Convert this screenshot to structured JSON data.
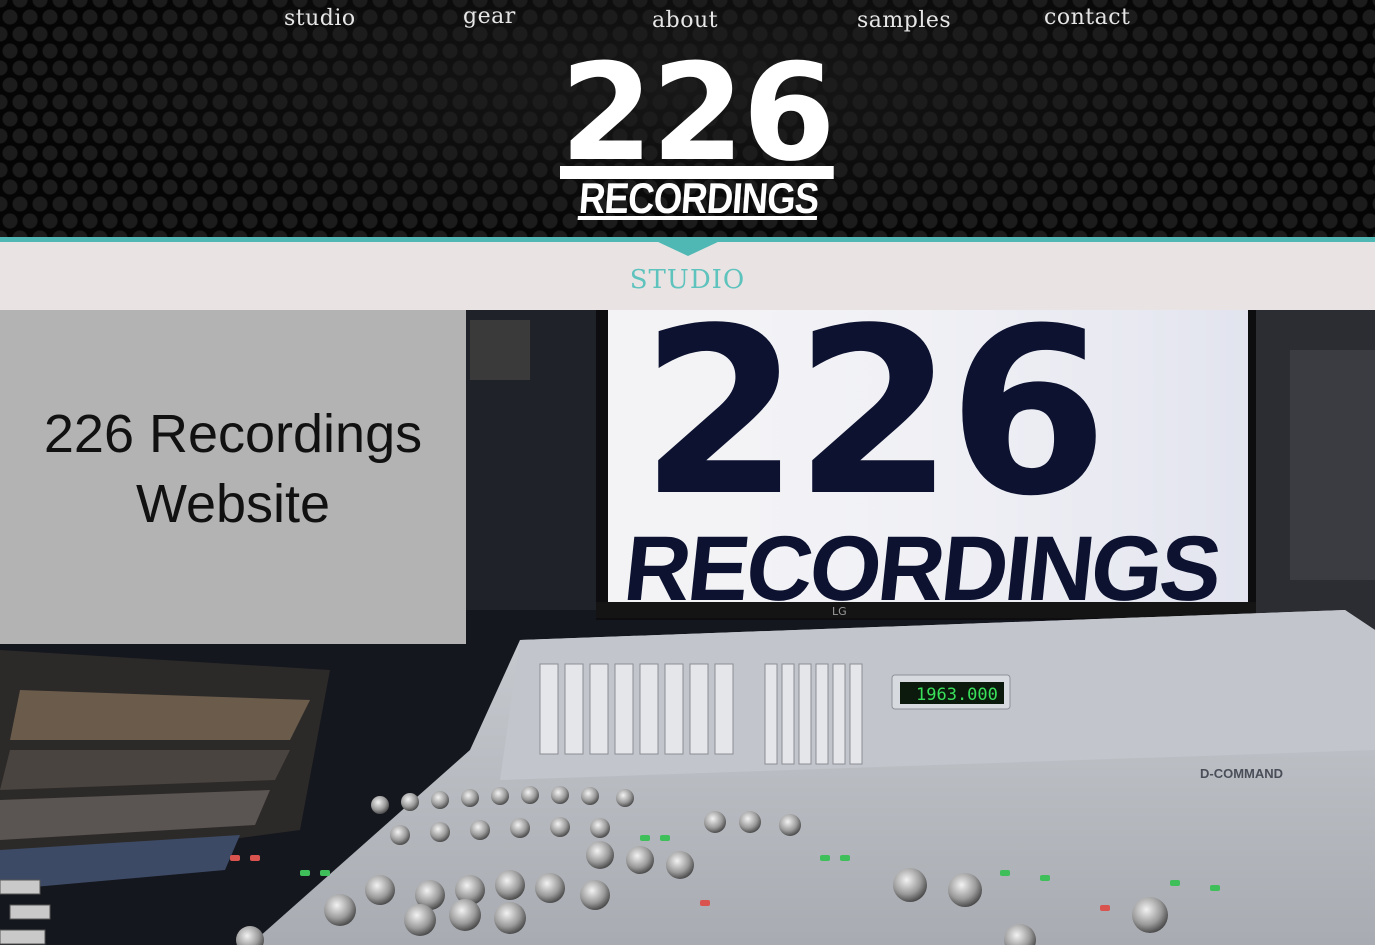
{
  "nav": {
    "items": [
      {
        "label": "studio"
      },
      {
        "label": "gear"
      },
      {
        "label": "about"
      },
      {
        "label": "samples"
      },
      {
        "label": "contact"
      }
    ]
  },
  "logo": {
    "number": "226",
    "word": "RECORDINGS"
  },
  "section": {
    "title": "STUDIO"
  },
  "hero": {
    "overlay_text": "226 Recordings Website",
    "screen_number": "226",
    "screen_word": "RECORDINGS",
    "monitor_brand": "LG",
    "counter_display": "1963.000",
    "console_brand": "D-COMMAND"
  }
}
